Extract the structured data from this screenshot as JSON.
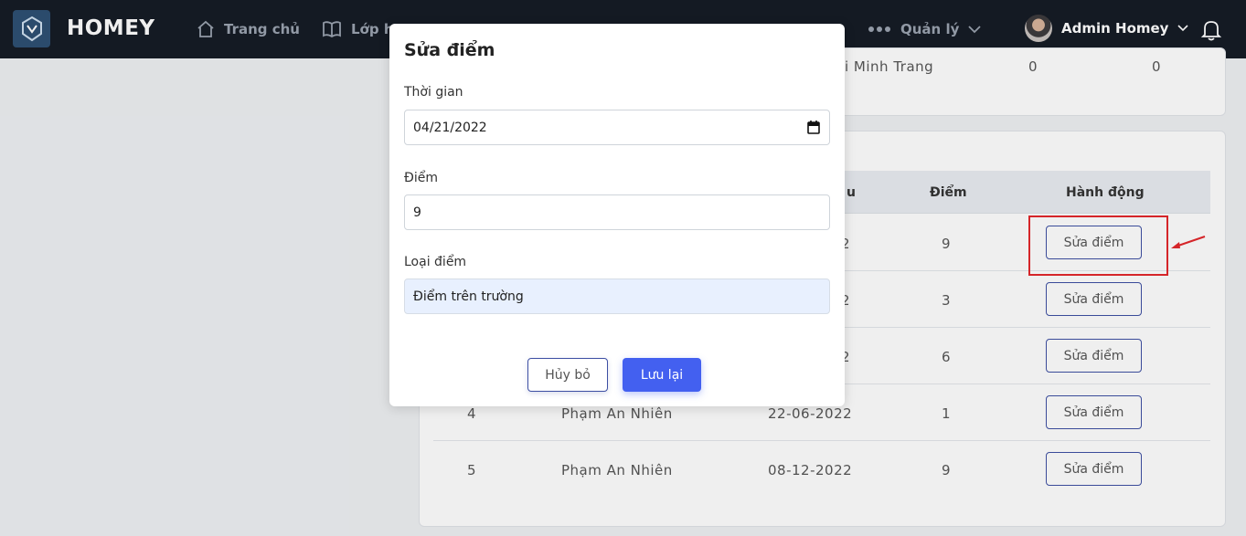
{
  "brand": "HOMEY",
  "nav": {
    "home": "Trang chủ",
    "classes": "Lớp h",
    "manage": "Quản lý"
  },
  "user": {
    "name": "Admin Homey"
  },
  "bg_top_row": {
    "name": "i Minh Trang",
    "c1": "0",
    "c2": "0"
  },
  "table": {
    "headers": {
      "date": "u",
      "score": "Điểm",
      "action": "Hành động"
    },
    "rows": [
      {
        "no": "",
        "name": "",
        "date": "2",
        "score": "9",
        "action": "Sửa điểm"
      },
      {
        "no": "",
        "name": "",
        "date": "2",
        "score": "3",
        "action": "Sửa điểm"
      },
      {
        "no": "",
        "name": "",
        "date": "2",
        "score": "6",
        "action": "Sửa điểm"
      },
      {
        "no": "4",
        "name": "Phạm An Nhiên",
        "date": "22-06-2022",
        "score": "1",
        "action": "Sửa điểm"
      },
      {
        "no": "5",
        "name": "Phạm An Nhiên",
        "date": "08-12-2022",
        "score": "9",
        "action": "Sửa điểm"
      }
    ]
  },
  "modal": {
    "title": "Sửa điểm",
    "time_label": "Thời gian",
    "time_value": "04/21/2022",
    "score_label": "Điểm",
    "score_value": "9",
    "type_label": "Loại điểm",
    "type_value": "Điểm trên trường",
    "cancel": "Hủy bỏ",
    "save": "Lưu lại"
  },
  "colors": {
    "nav_bg": "#141a24",
    "primary": "#4360f0",
    "highlight": "#e3262b"
  }
}
